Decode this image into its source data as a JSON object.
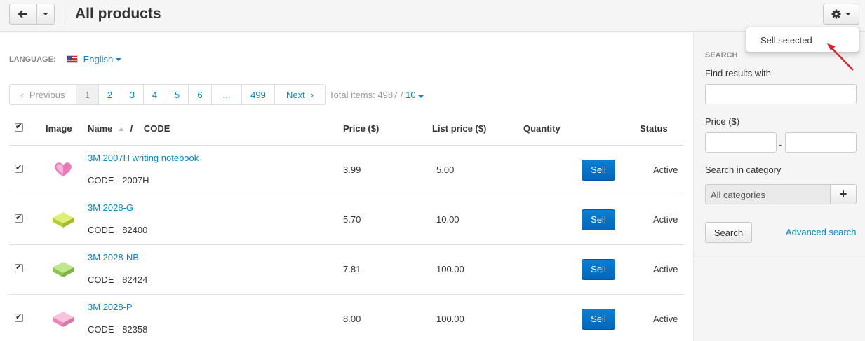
{
  "header": {
    "title": "All products"
  },
  "dropdown": {
    "item": "Sell selected"
  },
  "language": {
    "label": "LANGUAGE:",
    "value": "English"
  },
  "pagination": {
    "previous": "Previous",
    "pages": [
      "1",
      "2",
      "3",
      "4",
      "5",
      "6",
      "...",
      "499"
    ],
    "next": "Next",
    "total_label": "Total items: 4987 /",
    "per_page": "10"
  },
  "table": {
    "headers": {
      "image": "Image",
      "name": "Name",
      "slash": "/",
      "code": "CODE",
      "price": "Price ($)",
      "list_price": "List price ($)",
      "quantity": "Quantity",
      "status": "Status"
    },
    "code_label": "CODE",
    "sell_label": "Sell",
    "rows": [
      {
        "name": "3M 2007H writing notebook",
        "code": "2007H",
        "price": "3.99",
        "list_price": "5.00",
        "status": "Active",
        "color": "#e87ab8"
      },
      {
        "name": "3M 2028-G",
        "code": "82400",
        "price": "5.70",
        "list_price": "10.00",
        "status": "Active",
        "color": "#c8e04a"
      },
      {
        "name": "3M 2028-NB",
        "code": "82424",
        "price": "7.81",
        "list_price": "100.00",
        "status": "Active",
        "color": "#9ed65c"
      },
      {
        "name": "3M 2028-P",
        "code": "82358",
        "price": "8.00",
        "list_price": "100.00",
        "status": "Active",
        "color": "#f29ac4"
      }
    ]
  },
  "sidebar": {
    "title": "SEARCH",
    "find_label": "Find results with",
    "price_label": "Price ($)",
    "price_dash": "-",
    "category_label": "Search in category",
    "category_value": "All categories",
    "plus": "+",
    "search_button": "Search",
    "advanced_link": "Advanced search"
  },
  "colors": {
    "accent": "#0b84c4",
    "sell": "#0a6fc8"
  }
}
